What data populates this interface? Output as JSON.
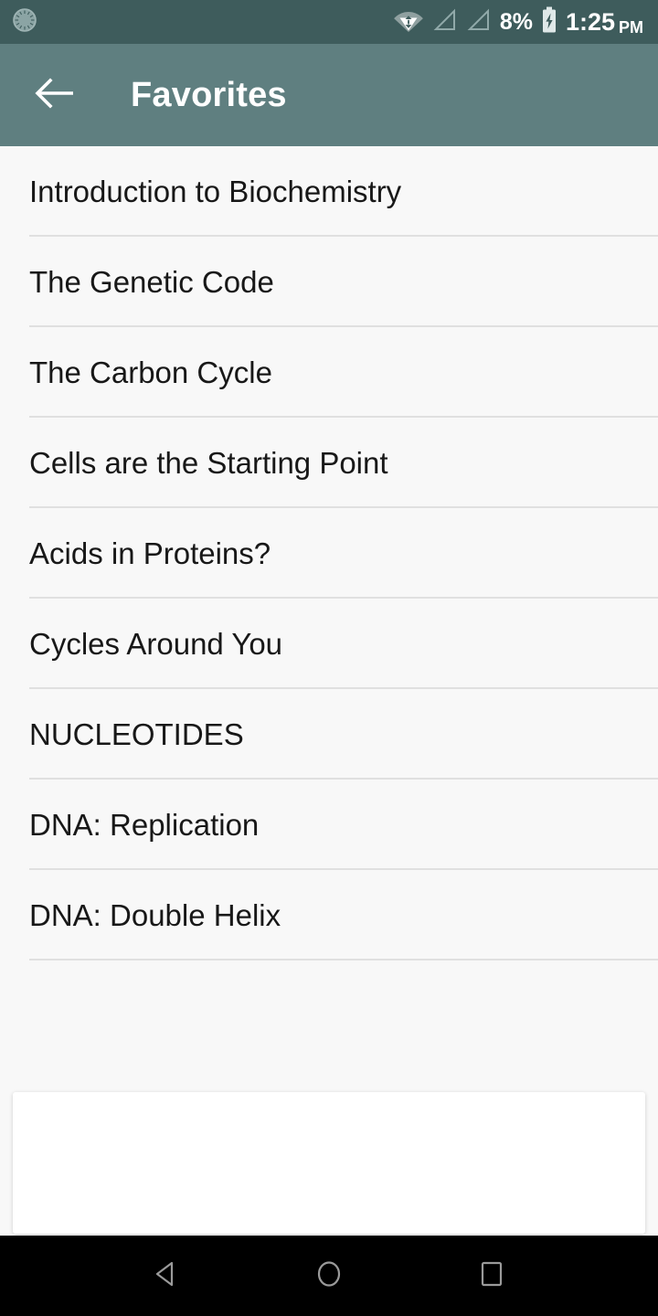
{
  "status_bar": {
    "background_color": "#3e5c5c",
    "notification_icon": "alarm-spinner-icon",
    "wifi_icon": "wifi-data-transfer-icon",
    "signal_icon_1": "signal-empty-icon",
    "signal_icon_2": "signal-empty-icon",
    "battery_percent": "8%",
    "battery_icon": "battery-charging-icon",
    "time": "1:25",
    "ampm": "PM"
  },
  "app_bar": {
    "background_color": "#5f7f80",
    "back_icon": "back-arrow-icon",
    "title": "Favorites"
  },
  "list": {
    "background_color": "#f8f8f8",
    "divider_color": "#e0e0e0",
    "items": [
      {
        "label": "Introduction to Biochemistry"
      },
      {
        "label": "The Genetic Code"
      },
      {
        "label": "The Carbon Cycle"
      },
      {
        "label": "Cells are the Starting Point"
      },
      {
        "label": "Acids in Proteins?"
      },
      {
        "label": "Cycles Around You"
      },
      {
        "label": "NUCLEOTIDES"
      },
      {
        "label": "DNA: Replication"
      },
      {
        "label": "DNA: Double Helix"
      }
    ]
  },
  "ad_card": {
    "background_color": "#ffffff",
    "content": ""
  },
  "nav_bar": {
    "background_color": "#000000",
    "buttons": [
      {
        "icon": "back-triangle-icon"
      },
      {
        "icon": "home-circle-icon"
      },
      {
        "icon": "recents-square-icon"
      }
    ]
  }
}
